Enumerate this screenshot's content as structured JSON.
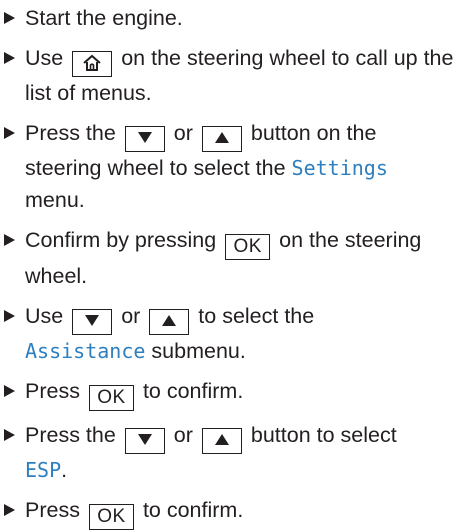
{
  "steps": [
    {
      "text": "Start the engine."
    },
    {
      "before": "Use",
      "after": "on the steering wheel to call up the list of menus."
    },
    {
      "before": "Press the",
      "mid": "or",
      "after": "button on the steering wheel to select the",
      "term": "Settings",
      "tail": "menu."
    },
    {
      "before": "Confirm by pressing",
      "key": "OK",
      "after": "on the steering wheel."
    },
    {
      "before": "Use",
      "mid": "or",
      "after": "to select the",
      "term": "Assistance",
      "tail": "submenu."
    },
    {
      "before": "Press",
      "key": "OK",
      "after": "to confirm."
    },
    {
      "before": "Press the",
      "mid": "or",
      "after": "button to select",
      "term": "ESP",
      "tail": "."
    },
    {
      "before": "Press",
      "key": "OK",
      "after": "to confirm."
    }
  ],
  "colors": {
    "text": "#231f20",
    "menu_term": "#2d7fbf"
  },
  "icons": {
    "bullet": "triangle-right-icon",
    "home": "home-icon",
    "down": "triangle-down-icon",
    "up": "triangle-up-icon"
  }
}
